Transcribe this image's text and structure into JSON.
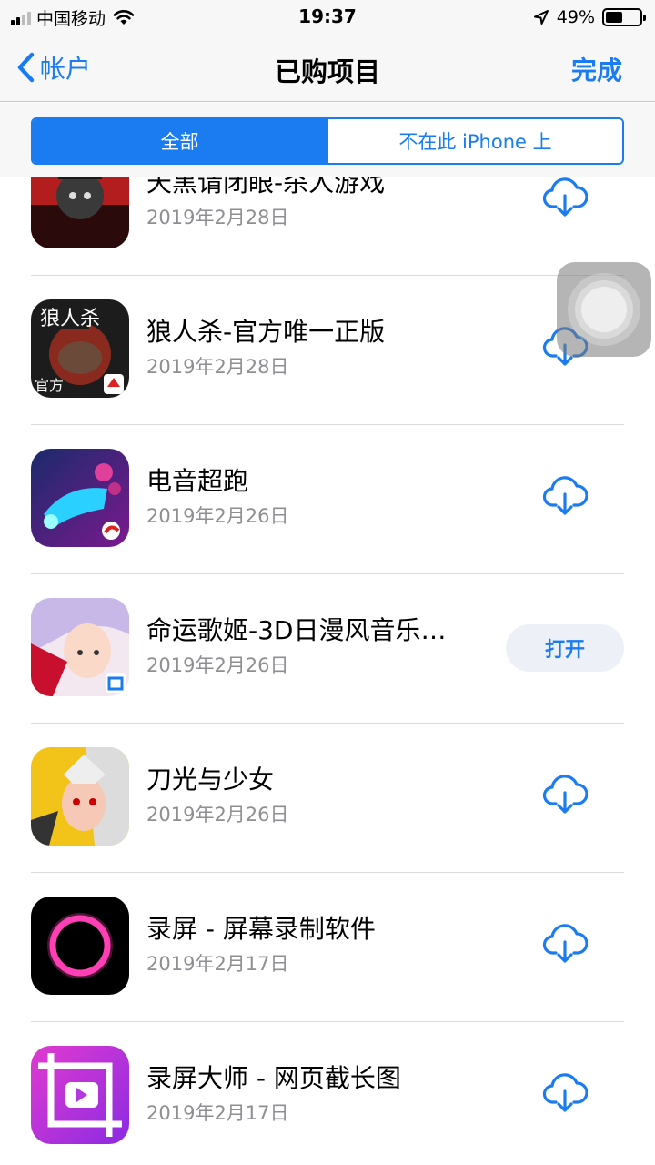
{
  "status_bar": {
    "carrier": "中国移动",
    "time": "19:37",
    "battery": "49%",
    "battery_level": 0.49
  },
  "nav": {
    "back_label": "帐户",
    "title": "已购项目",
    "done_label": "完成"
  },
  "segments": {
    "all": "全部",
    "not_on_device": "不在此 iPhone 上"
  },
  "apps": [
    {
      "name": "天黑请闭眼-杀人游戏",
      "date": "2019年2月28日",
      "action": "download"
    },
    {
      "name": "狼人杀-官方唯一正版",
      "date": "2019年2月28日",
      "action": "download"
    },
    {
      "name": "电音超跑",
      "date": "2019年2月26日",
      "action": "download"
    },
    {
      "name": "命运歌姬-3D日漫风音乐…",
      "date": "2019年2月26日",
      "action": "open",
      "action_label": "打开"
    },
    {
      "name": "刀光与少女",
      "date": "2019年2月26日",
      "action": "download"
    },
    {
      "name": "录屏 - 屏幕录制软件",
      "date": "2019年2月17日",
      "action": "download"
    },
    {
      "name": "录屏大师 - 网页截长图",
      "date": "2019年2月17日",
      "action": "download"
    }
  ],
  "colors": {
    "accent": "#1a7cf0",
    "secondary_text": "#8e8e93"
  },
  "icons": {
    "back": "chevron-left-icon",
    "download": "cloud-download-icon",
    "location": "location-arrow-icon",
    "wifi": "wifi-icon"
  }
}
